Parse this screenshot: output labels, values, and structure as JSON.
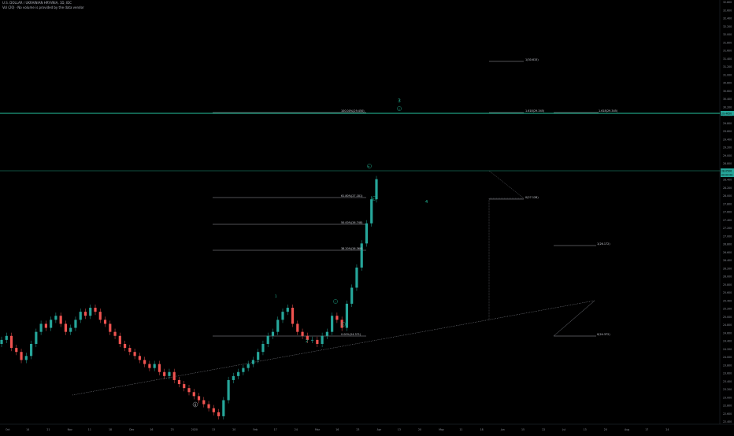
{
  "header": {
    "symbol": "U.S. DOLLAR / UKRAINIAN HRYVNIA, 1D, IDC",
    "volume_note": "Vol (20) · No volume is provided by the data vendor"
  },
  "colors": {
    "background": "#000000",
    "up": "#26a69a",
    "down": "#ef5350",
    "accent": "#26c6a2",
    "fib_line": "#c9ccd3",
    "dashed": "#9598a1",
    "price_tag": "#26a69a"
  },
  "price_axis": {
    "labels": [
      "32.800",
      "32.600",
      "32.400",
      "32.200",
      "32.000",
      "31.800",
      "31.600",
      "31.400",
      "31.200",
      "31.000",
      "30.800",
      "30.600",
      "30.400",
      "30.200",
      "30.000",
      "29.800",
      "29.600",
      "29.400",
      "29.200",
      "29.000",
      "28.800",
      "28.600",
      "28.400",
      "28.200",
      "28.000",
      "27.800",
      "27.600",
      "27.400",
      "27.200",
      "27.000",
      "26.800",
      "26.600",
      "26.400",
      "26.200",
      "26.000",
      "25.800",
      "25.600",
      "25.400",
      "25.200",
      "25.000",
      "24.800",
      "24.600",
      "24.400",
      "24.200",
      "24.000",
      "23.800",
      "23.600",
      "23.400",
      "23.200",
      "23.000",
      "22.800",
      "22.600",
      "22.400"
    ],
    "tags": [
      {
        "text": "29.4650",
        "type": "fill"
      },
      {
        "text": "28.0506",
        "type": "fill"
      },
      {
        "text": "00:00:00",
        "type": "fill"
      }
    ]
  },
  "time_axis": {
    "labels": [
      "Oct",
      "14",
      "21",
      "Nov",
      "11",
      "18",
      "Dec",
      "16",
      "23",
      "2020",
      "13",
      "20",
      "Feb",
      "17",
      "24",
      "Mar",
      "16",
      "23",
      "Apr",
      "13",
      "20",
      "May",
      "11",
      "18",
      "Jun",
      "15",
      "22",
      "Jul",
      "13",
      "20",
      "Aug",
      "17",
      "24"
    ]
  },
  "fib_levels": [
    {
      "id": "f100",
      "label": "100.00%(29.450)"
    },
    {
      "id": "f618",
      "label": "61.80%(27.181)"
    },
    {
      "id": "f50",
      "label": "50.00%(26.748)"
    },
    {
      "id": "f382",
      "label": "38.20%(26.360)"
    },
    {
      "id": "f0",
      "label": "0.00%(24.371)"
    }
  ],
  "projections": [
    {
      "id": "p1272",
      "label": "1.27%(29.343)"
    },
    {
      "id": "p1618a",
      "label": "1.618(29.345)"
    },
    {
      "id": "p1618b",
      "label": "1.618(29.345)"
    },
    {
      "id": "p_top",
      "label": "1(30.615)"
    },
    {
      "id": "p_mid",
      "label": "0(27.128)"
    },
    {
      "id": "p_low1",
      "label": "1(26.172)"
    },
    {
      "id": "p_low2",
      "label": "0(24.372)"
    }
  ],
  "wave_labels": [
    {
      "id": "w4",
      "text": "4"
    },
    {
      "id": "w1",
      "text": "1"
    },
    {
      "id": "w2",
      "text": "2"
    },
    {
      "id": "w3",
      "text": "3"
    },
    {
      "id": "w4b",
      "text": "4"
    },
    {
      "id": "wi",
      "text": "i"
    },
    {
      "id": "wii",
      "text": "ii"
    },
    {
      "id": "wiii",
      "text": "iii"
    },
    {
      "id": "wiv",
      "text": "iv"
    },
    {
      "id": "wv",
      "text": "v"
    }
  ],
  "chart_data": {
    "type": "candlestick",
    "title": "U.S. DOLLAR / UKRAINIAN HRYVNIA, 1D, IDC",
    "x_range": [
      "Oct 2019",
      "Aug 2020"
    ],
    "y_range": [
      22.4,
      32.8
    ],
    "grid": true,
    "ohlc_close_series_approx": [
      24.4,
      24.5,
      24.2,
      24.1,
      23.9,
      24.0,
      24.3,
      24.6,
      24.8,
      24.7,
      24.9,
      25.0,
      24.8,
      24.6,
      24.7,
      24.9,
      25.1,
      25.0,
      25.2,
      25.1,
      24.9,
      24.8,
      24.6,
      24.5,
      24.3,
      24.2,
      24.1,
      24.0,
      23.9,
      23.8,
      23.7,
      23.8,
      23.6,
      23.5,
      23.6,
      23.4,
      23.3,
      23.2,
      23.1,
      23.0,
      22.9,
      22.8,
      22.7,
      22.6,
      22.5,
      22.9,
      23.4,
      23.5,
      23.6,
      23.7,
      23.8,
      23.9,
      24.1,
      24.3,
      24.5,
      24.6,
      24.9,
      25.1,
      25.2,
      24.8,
      24.6,
      24.5,
      24.4,
      24.4,
      24.3,
      24.5,
      24.6,
      25.0,
      24.9,
      24.7,
      25.3,
      25.7,
      26.2,
      26.8,
      27.3,
      27.9,
      28.4
    ]
  }
}
